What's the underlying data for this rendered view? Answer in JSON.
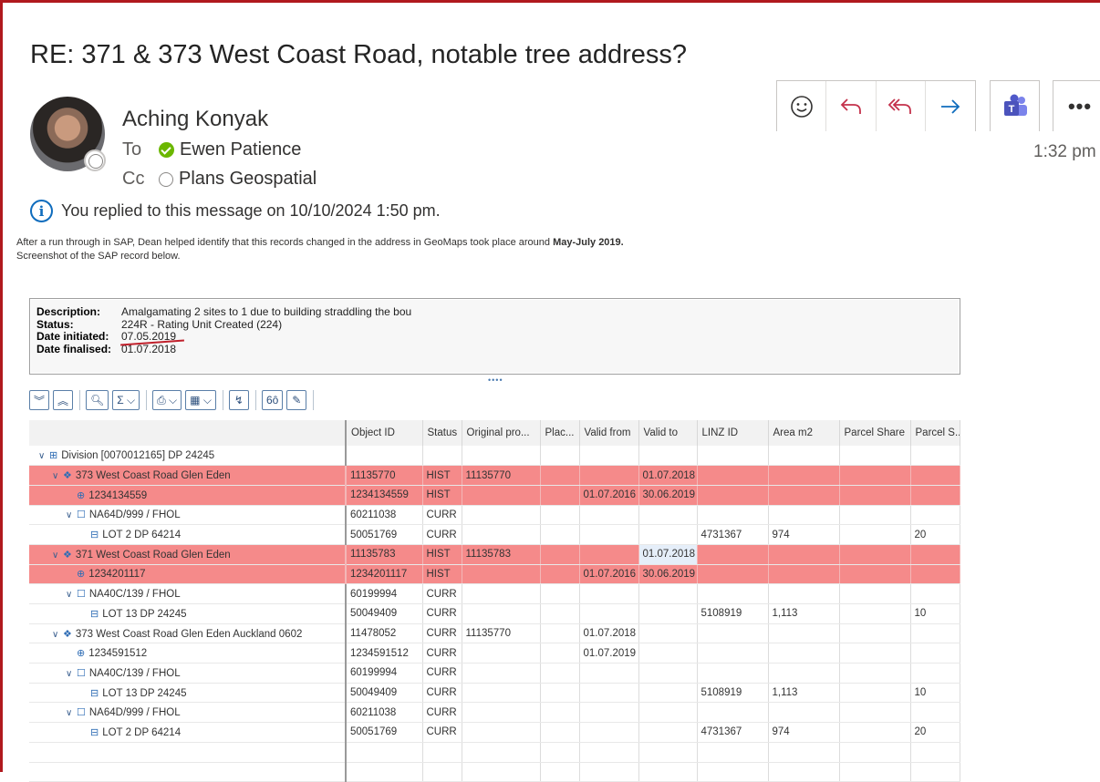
{
  "email": {
    "subject": "RE: 371 & 373 West Coast Road, notable tree address?",
    "sender": "Aching Konyak",
    "to_label": "To",
    "to_name": "Ewen Patience",
    "cc_label": "Cc",
    "cc_name": "Plans Geospatial",
    "time": "1:32 pm",
    "info": "You replied to this message on 10/10/2024 1:50 pm.",
    "body_line1_a": "After a run through in SAP, Dean helped identify that this records changed in the address in GeoMaps took place around ",
    "body_line1_bold": "May-July 2019.",
    "body_line2": "Screenshot of the SAP record below.",
    "actions": [
      "emoji-icon",
      "reply-icon",
      "reply-all-icon",
      "forward-icon"
    ],
    "more": "•••"
  },
  "sap": {
    "description_label": "Description:",
    "description": "Amalgamating 2 sites to 1 due to building straddling the bou",
    "status_label": "Status:",
    "status": "224R - Rating Unit Created (224)",
    "initiated_label": "Date initiated:",
    "initiated": "07.05.2019",
    "finalised_label": "Date finalised:",
    "finalised": "01.07.2018",
    "columns": [
      "",
      "Object ID",
      "Status",
      "Original pro...",
      "Plac...",
      "Valid from",
      "Valid to",
      "LINZ ID",
      "Area m2",
      "Parcel Share",
      "Parcel S..."
    ],
    "rows": [
      {
        "label": "Division [0070012165] DP 24245",
        "icon": "division",
        "indent": 0,
        "cells": [
          "",
          "",
          "",
          "",
          "",
          "",
          "",
          "",
          "",
          ""
        ]
      },
      {
        "label": "373 West Coast Road Glen Eden",
        "icon": "address",
        "indent": 1,
        "hist": true,
        "cells": [
          "11135770",
          "HIST",
          "11135770",
          "",
          "",
          "01.07.2018",
          "",
          "",
          "",
          ""
        ]
      },
      {
        "label": "1234134559",
        "icon": "search",
        "indent": 2,
        "hist": true,
        "cells": [
          "1234134559",
          "HIST",
          "",
          "",
          "01.07.2016",
          "30.06.2019",
          "",
          "",
          "",
          ""
        ]
      },
      {
        "label": "NA64D/999 / FHOL",
        "icon": "title",
        "indent": 2,
        "cells": [
          "60211038",
          "CURR",
          "",
          "",
          "",
          "",
          "",
          "",
          "",
          ""
        ]
      },
      {
        "label": "LOT 2 DP 64214",
        "icon": "lot",
        "indent": 3,
        "cells": [
          "50051769",
          "CURR",
          "",
          "",
          "",
          "",
          "4731367",
          "974",
          "",
          "20"
        ]
      },
      {
        "label": "371 West Coast Road Glen Eden",
        "icon": "address",
        "indent": 1,
        "hist": true,
        "vt": true,
        "cells": [
          "11135783",
          "HIST",
          "11135783",
          "",
          "",
          "01.07.2018",
          "",
          "",
          "",
          ""
        ]
      },
      {
        "label": "1234201117",
        "icon": "search",
        "indent": 2,
        "hist": true,
        "cells": [
          "1234201117",
          "HIST",
          "",
          "",
          "01.07.2016",
          "30.06.2019",
          "",
          "",
          "",
          ""
        ]
      },
      {
        "label": "NA40C/139 / FHOL",
        "icon": "title",
        "indent": 2,
        "cells": [
          "60199994",
          "CURR",
          "",
          "",
          "",
          "",
          "",
          "",
          "",
          ""
        ]
      },
      {
        "label": "LOT 13 DP 24245",
        "icon": "lot",
        "indent": 3,
        "cells": [
          "50049409",
          "CURR",
          "",
          "",
          "",
          "",
          "5108919",
          "1,113",
          "",
          "10"
        ]
      },
      {
        "label": "373 West Coast Road Glen Eden Auckland 0602",
        "icon": "address",
        "indent": 1,
        "cells": [
          "11478052",
          "CURR",
          "11135770",
          "",
          "01.07.2018",
          "",
          "",
          "",
          "",
          ""
        ]
      },
      {
        "label": "1234591512",
        "icon": "search",
        "indent": 2,
        "cells": [
          "1234591512",
          "CURR",
          "",
          "",
          "01.07.2019",
          "",
          "",
          "",
          "",
          ""
        ]
      },
      {
        "label": "NA40C/139 / FHOL",
        "icon": "title",
        "indent": 2,
        "cells": [
          "60199994",
          "CURR",
          "",
          "",
          "",
          "",
          "",
          "",
          "",
          ""
        ]
      },
      {
        "label": "LOT 13 DP 24245",
        "icon": "lot",
        "indent": 3,
        "cells": [
          "50049409",
          "CURR",
          "",
          "",
          "",
          "",
          "5108919",
          "1,113",
          "",
          "10"
        ]
      },
      {
        "label": "NA64D/999 / FHOL",
        "icon": "title",
        "indent": 2,
        "cells": [
          "60211038",
          "CURR",
          "",
          "",
          "",
          "",
          "",
          "",
          "",
          ""
        ]
      },
      {
        "label": "LOT 2 DP 64214",
        "icon": "lot",
        "indent": 3,
        "cells": [
          "50051769",
          "CURR",
          "",
          "",
          "",
          "",
          "4731367",
          "974",
          "",
          "20"
        ]
      },
      {
        "label": "",
        "icon": "",
        "indent": 0,
        "cells": [
          "",
          "",
          "",
          "",
          "",
          "",
          "",
          "",
          "",
          ""
        ]
      },
      {
        "label": "",
        "icon": "",
        "indent": 0,
        "cells": [
          "",
          "",
          "",
          "",
          "",
          "",
          "",
          "",
          "",
          ""
        ]
      }
    ]
  }
}
